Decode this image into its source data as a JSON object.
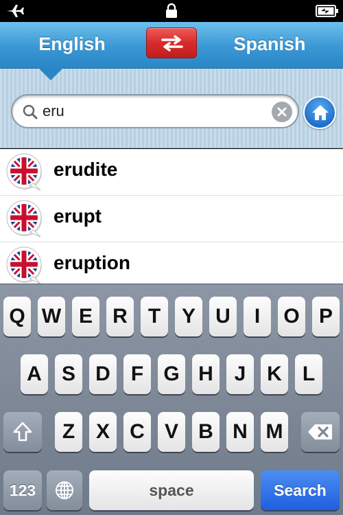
{
  "header": {
    "source_language": "English",
    "target_language": "Spanish",
    "swap_icon": "swap-arrows-icon"
  },
  "search": {
    "value": "eru",
    "icons": {
      "search": "magnifier-icon",
      "clear": "clear-x-icon",
      "home": "home-icon"
    }
  },
  "results": [
    {
      "word": "erudite",
      "flag_icon": "uk-flag-icon"
    },
    {
      "word": "erupt",
      "flag_icon": "uk-flag-icon"
    },
    {
      "word": "eruption",
      "flag_icon": "uk-flag-icon"
    }
  ],
  "keyboard": {
    "row1": [
      "Q",
      "W",
      "E",
      "R",
      "T",
      "Y",
      "U",
      "I",
      "O",
      "P"
    ],
    "row2": [
      "A",
      "S",
      "D",
      "F",
      "G",
      "H",
      "J",
      "K",
      "L"
    ],
    "row3": [
      "Z",
      "X",
      "C",
      "V",
      "B",
      "N",
      "M"
    ],
    "numbers_label": "123",
    "space_label": "space",
    "search_label": "Search"
  },
  "colors": {
    "header_blue": "#3a97d4",
    "swap_red": "#d82b2b",
    "search_key_blue": "#1f5ee0"
  }
}
